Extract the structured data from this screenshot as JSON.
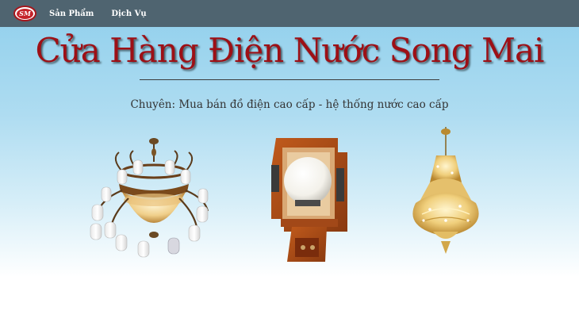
{
  "nav": {
    "logo_text": "SM",
    "links": [
      "Sản Phẩm",
      "Dịch Vụ"
    ]
  },
  "hero": {
    "title": "Cửa Hàng Điện Nước Song Mai",
    "tagline": "Chuyên: Mua bán đồ điện cao cấp - hệ thống nước cao cấp"
  },
  "products": [
    {
      "icon": "bronze-chandelier-image"
    },
    {
      "icon": "wooden-wall-lamp-image"
    },
    {
      "icon": "crystal-chandelier-image"
    }
  ],
  "colors": {
    "navbar": "#4f6470",
    "title": "#9d1016",
    "logo": "#c5232a",
    "background_top": "#8fcfec"
  }
}
